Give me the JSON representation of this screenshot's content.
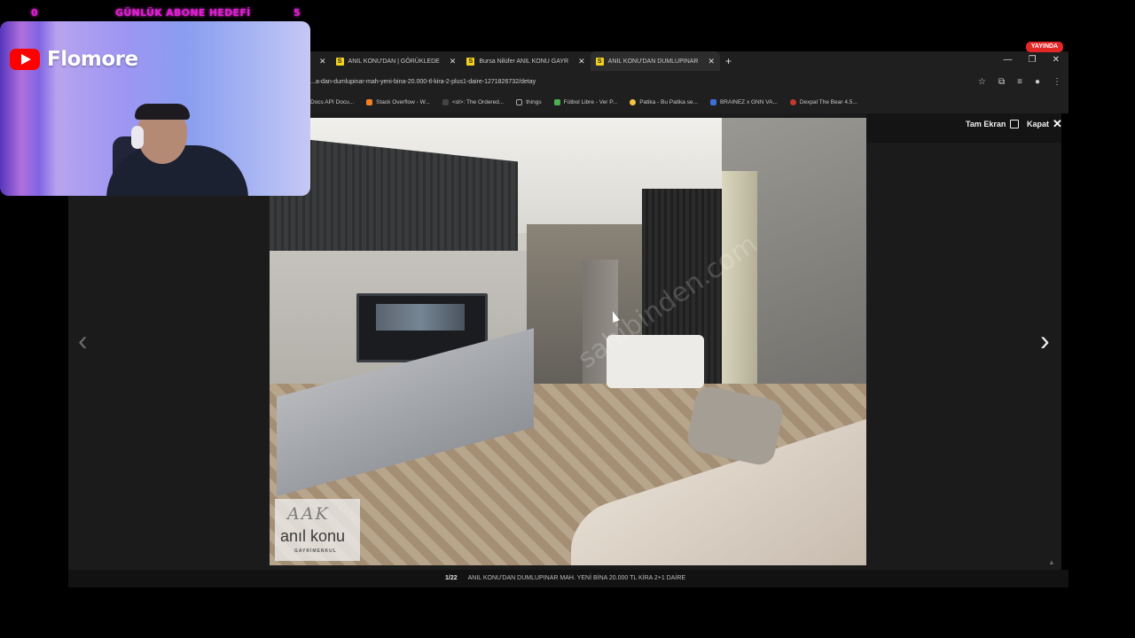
{
  "stream": {
    "goal_left": "0",
    "goal_title": "GÜNLÜK ABONE HEDEFİ",
    "goal_right": "5",
    "channel_name": "Flomore",
    "live_label": "YAYINDA"
  },
  "browser": {
    "tabs": [
      {
        "label": "ANIL KONU'DAN | GÖRÜKLEDE",
        "active": false
      },
      {
        "label": "Bursa Nilüfer ANIL KONU GAYR",
        "active": false
      },
      {
        "label": "ANIL KONU'DAN DUMLUPINAR",
        "active": true
      }
    ],
    "url": "...a-dan-dumlupinar-mah-yeni-bina-20.000-tl-kira-2-plus1-daire-1271826732/detay",
    "bookmarks": [
      {
        "label": "Docs API Docu...",
        "color": "#8ab4f8"
      },
      {
        "label": "Stack Overflow - W...",
        "color": "#f48024"
      },
      {
        "label": "<ol>: The Ordered...",
        "color": "#444444"
      },
      {
        "label": "things",
        "color": "#aaaaaa"
      },
      {
        "label": "Fútbol Libre - Ver P...",
        "color": "#4caf50"
      },
      {
        "label": "Patika - Bu Patika se...",
        "color": "#f4c542"
      },
      {
        "label": "BRAINEZ x GNN VA...",
        "color": "#3d6fd8"
      },
      {
        "label": "Dexpal The Bear 4.5...",
        "color": "#c0392b"
      }
    ]
  },
  "viewer": {
    "fullscreen_label": "Tam Ekran",
    "close_label": "Kapat",
    "counter": "1/22",
    "caption": "ANIL KONU'DAN DUMLUPINAR MAH. YENİ BİNA 20.000 TL KİRA 2+1 DAİRE",
    "logo_mark": "AAK",
    "logo_name": "anıl konu",
    "logo_sub": "GAYRİMENKUL",
    "watermark": "sahibinden.com"
  }
}
